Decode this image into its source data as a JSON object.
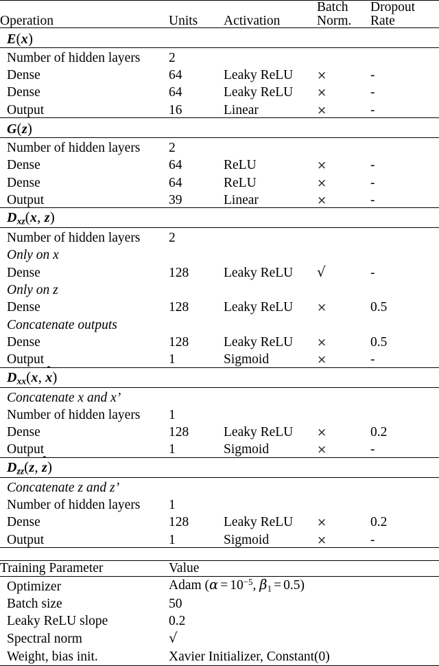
{
  "architecture_table": {
    "columns": [
      {
        "id": "operation",
        "label": "Operation",
        "line1": "Operation",
        "line2": ""
      },
      {
        "id": "units",
        "label": "Units",
        "line1": "Units",
        "line2": ""
      },
      {
        "id": "activation",
        "label": "Activation",
        "line1": "Activation",
        "line2": ""
      },
      {
        "id": "batch_norm",
        "label": "Batch Norm.",
        "line1": "Batch",
        "line2": "Norm."
      },
      {
        "id": "dropout_rate",
        "label": "Dropout Rate",
        "line1": "Dropout",
        "line2": "Rate"
      }
    ],
    "sections": [
      {
        "title": "E(x)",
        "title_parts": {
          "base": "E",
          "sub": "",
          "args": "(x)"
        },
        "rows": [
          {
            "type": "data",
            "operation": "Number of hidden layers",
            "units": "2",
            "units_bold": true,
            "activation": "",
            "batch_norm": "",
            "dropout_rate": ""
          },
          {
            "type": "data",
            "operation": "Dense",
            "units": "64",
            "units_bold": true,
            "activation": "Leaky ReLU",
            "batch_norm": "×",
            "dropout_rate": "-"
          },
          {
            "type": "data",
            "operation": "Dense",
            "units": "64",
            "units_bold": true,
            "activation": "Leaky ReLU",
            "batch_norm": "×",
            "dropout_rate": "-"
          },
          {
            "type": "data",
            "operation": "Output",
            "units": "16",
            "units_bold": true,
            "activation": "Linear",
            "batch_norm": "×",
            "dropout_rate": "-"
          }
        ]
      },
      {
        "title": "G(z)",
        "title_parts": {
          "base": "G",
          "sub": "",
          "args": "(z)"
        },
        "rows": [
          {
            "type": "data",
            "operation": "Number of hidden layers",
            "units": "2",
            "units_bold": true,
            "activation": "",
            "batch_norm": "",
            "dropout_rate": ""
          },
          {
            "type": "data",
            "operation": "Dense",
            "units": "64",
            "units_bold": true,
            "activation": "ReLU",
            "batch_norm": "×",
            "dropout_rate": "-"
          },
          {
            "type": "data",
            "operation": "Dense",
            "units": "64",
            "units_bold": true,
            "activation": "ReLU",
            "batch_norm": "×",
            "dropout_rate": "-"
          },
          {
            "type": "data",
            "operation": "Output",
            "units": "39",
            "units_bold": false,
            "activation": "Linear",
            "batch_norm": "×",
            "dropout_rate": "-"
          }
        ]
      },
      {
        "title": "D_xz(x, z)",
        "title_parts": {
          "base": "D",
          "sub": "xz",
          "args": "(x, z)"
        },
        "rows": [
          {
            "type": "data",
            "operation": "Number of hidden layers",
            "units": "2",
            "units_bold": true,
            "activation": "",
            "batch_norm": "",
            "dropout_rate": ""
          },
          {
            "type": "note",
            "operation": "Only on x"
          },
          {
            "type": "data",
            "operation": "Dense",
            "units": "128",
            "units_bold": true,
            "activation": "Leaky ReLU",
            "batch_norm": "√",
            "dropout_rate": "-"
          },
          {
            "type": "note",
            "operation": "Only on z"
          },
          {
            "type": "data",
            "operation": "Dense",
            "units": "128",
            "units_bold": true,
            "activation": "Leaky ReLU",
            "batch_norm": "×",
            "dropout_rate": "0.5"
          },
          {
            "type": "note",
            "operation": "Concatenate outputs"
          },
          {
            "type": "data",
            "operation": "Dense",
            "units": "128",
            "units_bold": true,
            "activation": "Leaky ReLU",
            "batch_norm": "×",
            "dropout_rate": "0.5"
          },
          {
            "type": "data",
            "operation": "Output",
            "units": "1",
            "units_bold": false,
            "activation": "Sigmoid",
            "batch_norm": "×",
            "dropout_rate": "-"
          }
        ]
      },
      {
        "title": "D_xx(x, x̂)",
        "title_parts": {
          "base": "D",
          "sub": "xx",
          "args": "(x, x̂)"
        },
        "rows": [
          {
            "type": "note",
            "operation": "Concatenate x and x’"
          },
          {
            "type": "data",
            "operation": "Number of hidden layers",
            "units": "1",
            "units_bold": true,
            "activation": "",
            "batch_norm": "",
            "dropout_rate": ""
          },
          {
            "type": "data",
            "operation": "Dense",
            "units": "128",
            "units_bold": true,
            "activation": "Leaky ReLU",
            "batch_norm": "×",
            "dropout_rate": "0.2"
          },
          {
            "type": "data",
            "operation": "Output",
            "units": "1",
            "units_bold": false,
            "activation": "Sigmoid",
            "batch_norm": "×",
            "dropout_rate": "-"
          }
        ]
      },
      {
        "title": "D_zz(z, ẑ)",
        "title_parts": {
          "base": "D",
          "sub": "zz",
          "args": "(z, ẑ)"
        },
        "rows": [
          {
            "type": "note",
            "operation": "Concatenate z and z’"
          },
          {
            "type": "data",
            "operation": "Number of hidden layers",
            "units": "1",
            "units_bold": true,
            "activation": "",
            "batch_norm": "",
            "dropout_rate": ""
          },
          {
            "type": "data",
            "operation": "Dense",
            "units": "128",
            "units_bold": true,
            "activation": "Leaky ReLU",
            "batch_norm": "×",
            "dropout_rate": "0.2"
          },
          {
            "type": "data",
            "operation": "Output",
            "units": "1",
            "units_bold": false,
            "activation": "Sigmoid",
            "batch_norm": "×",
            "dropout_rate": "-"
          }
        ]
      }
    ]
  },
  "training_table": {
    "columns": [
      {
        "id": "parameter",
        "label": "Training Parameter"
      },
      {
        "id": "value",
        "label": "Value"
      }
    ],
    "rows": [
      {
        "parameter": "Optimizer",
        "value": "Adam (α = 10⁻⁵, β₁ = 0.5)",
        "value_bold": false,
        "is_math": true
      },
      {
        "parameter": "Batch size",
        "value": "50",
        "value_bold": true,
        "is_math": false
      },
      {
        "parameter": "Leaky ReLU slope",
        "value": "0.2",
        "value_bold": false,
        "is_math": false
      },
      {
        "parameter": "Spectral norm",
        "value": "√",
        "value_bold": false,
        "is_math": false
      },
      {
        "parameter": "Weight, bias init.",
        "value": "Xavier Initializer, Constant(0)",
        "value_bold": false,
        "is_math": false
      }
    ]
  },
  "symbols": {
    "cross": "×",
    "radical": "√",
    "dash": "-"
  }
}
